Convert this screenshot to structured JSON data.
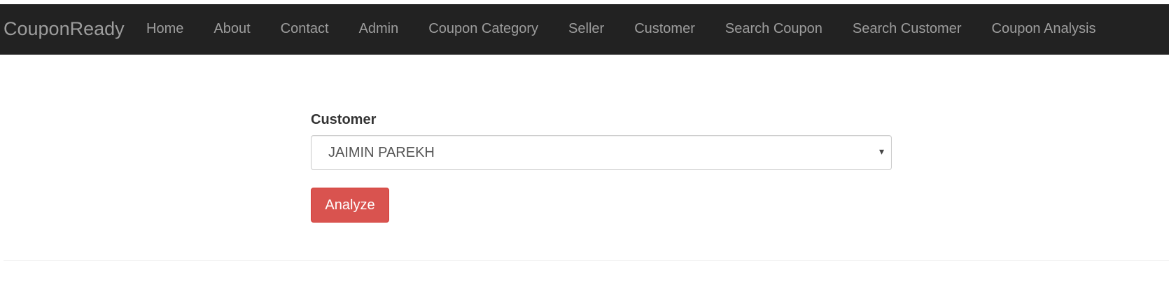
{
  "navbar": {
    "brand": "CouponReady",
    "items": [
      {
        "label": "Home"
      },
      {
        "label": "About"
      },
      {
        "label": "Contact"
      },
      {
        "label": "Admin"
      },
      {
        "label": "Coupon Category"
      },
      {
        "label": "Seller"
      },
      {
        "label": "Customer"
      },
      {
        "label": "Search Coupon"
      },
      {
        "label": "Search Customer"
      },
      {
        "label": "Coupon Analysis"
      }
    ]
  },
  "form": {
    "customer_label": "Customer",
    "customer_selected": "JAIMIN PAREKH",
    "caret_icon": "▾",
    "analyze_label": "Analyze"
  },
  "colors": {
    "navbar_bg": "#222222",
    "nav_text": "#9d9d9d",
    "button_danger": "#d9534f"
  }
}
